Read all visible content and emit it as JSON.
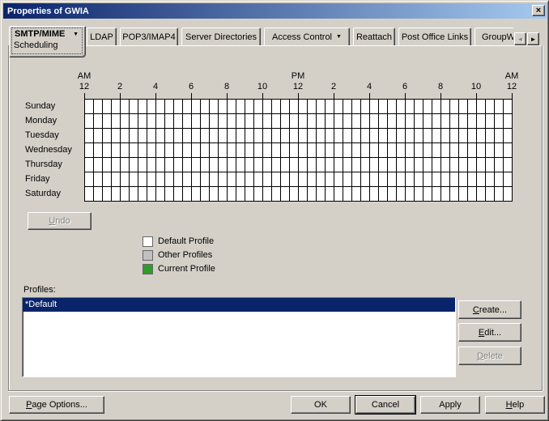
{
  "window": {
    "title": "Properties of GWIA",
    "close_icon_glyph": "×"
  },
  "icons": {
    "dropdown_glyph": "▼",
    "scroll_left_glyph": "◄",
    "scroll_right_glyph": "►"
  },
  "tab_bar": {
    "active_tab": {
      "label": "SMTP/MIME",
      "page": "Scheduling",
      "has_dropdown": true
    },
    "tabs": [
      {
        "label": "LDAP",
        "has_dropdown": false,
        "truncated": false
      },
      {
        "label": "POP3/IMAP4",
        "has_dropdown": false,
        "truncated": false
      },
      {
        "label": "Server Directories",
        "has_dropdown": false,
        "truncated": false
      },
      {
        "label": "Access Control",
        "has_dropdown": true,
        "truncated": false
      },
      {
        "label": "Reattach",
        "has_dropdown": false,
        "truncated": false
      },
      {
        "label": "Post Office Links",
        "has_dropdown": false,
        "truncated": false
      },
      {
        "label": "GroupW",
        "has_dropdown": false,
        "truncated": true
      }
    ],
    "scroll_left_enabled": false,
    "scroll_right_enabled": true
  },
  "schedule": {
    "period_labels": [
      {
        "text": "AM",
        "tick_index": 0
      },
      {
        "text": "PM",
        "tick_index": 6
      },
      {
        "text": "AM",
        "tick_index": 12
      }
    ],
    "hour_tick_labels": [
      "12",
      "2",
      "4",
      "6",
      "8",
      "10",
      "12",
      "2",
      "4",
      "6",
      "8",
      "10",
      "12"
    ],
    "days": [
      "Sunday",
      "Monday",
      "Tuesday",
      "Wednesday",
      "Thursday",
      "Friday",
      "Saturday"
    ],
    "columns_per_day": 48,
    "all_cells_state": "default-profile",
    "cell_colors": {
      "default-profile": "#FFFFFF",
      "other-profiles": "#C0C0C0",
      "current-profile": "#2E9B2E"
    }
  },
  "undo_button": {
    "label": "Undo",
    "mnemonic_index": 0,
    "enabled": false
  },
  "legend": [
    {
      "label": "Default Profile",
      "color": "#FFFFFF"
    },
    {
      "label": "Other Profiles",
      "color": "#C0C0C0"
    },
    {
      "label": "Current Profile",
      "color": "#2E9B2E"
    }
  ],
  "profiles": {
    "label": "Profiles:",
    "items": [
      {
        "name": "*Default",
        "selected": true
      }
    ],
    "action_buttons": [
      {
        "label": "Create...",
        "mnemonic_index": 0,
        "enabled": true
      },
      {
        "label": "Edit...",
        "mnemonic_index": 0,
        "enabled": true
      },
      {
        "label": "Delete",
        "mnemonic_index": 0,
        "enabled": false
      }
    ]
  },
  "footer": {
    "page_options_button": {
      "label": "Page Options...",
      "mnemonic_index": 0,
      "enabled": true
    },
    "buttons": [
      {
        "label": "OK",
        "mnemonic_index": -1,
        "enabled": true,
        "is_default": false
      },
      {
        "label": "Cancel",
        "mnemonic_index": -1,
        "enabled": true,
        "is_default": true
      },
      {
        "label": "Apply",
        "mnemonic_index": -1,
        "enabled": true,
        "is_default": false
      },
      {
        "label": "Help",
        "mnemonic_index": 0,
        "enabled": true,
        "is_default": false
      }
    ]
  },
  "colors": {
    "dialog_face": "#D4D0C8",
    "title_gradient_left": "#0A246A",
    "title_gradient_right": "#A6CAF0",
    "title_text": "#FFFFFF",
    "selection_background": "#0A246A",
    "selection_text": "#FFFFFF",
    "grid_line": "#000000",
    "disabled_text": "#808080"
  }
}
